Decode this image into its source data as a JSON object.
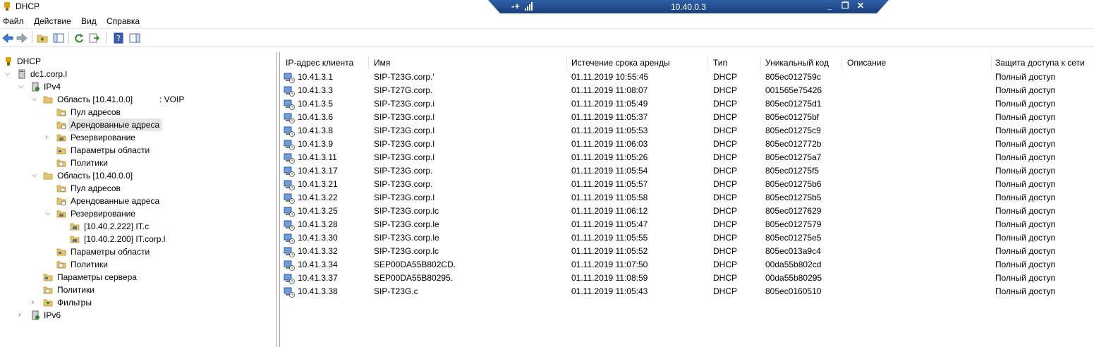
{
  "window": {
    "title": "DHCP"
  },
  "rdp": {
    "ip": "10.40.0.3",
    "pin": "-+",
    "minimize": "_",
    "restore": "❐",
    "close": "✕"
  },
  "menu": {
    "file": "Файл",
    "action": "Действие",
    "view": "Вид",
    "help": "Справка"
  },
  "tree": {
    "root": "DHCP",
    "server": "dc1.corp.l",
    "ipv4": "IPv4",
    "scope1": "Область [10.41.0.0]",
    "scope1_suffix": ": VOIP",
    "pool1": "Пул адресов",
    "leases1": "Арендованные адреса",
    "reservations1": "Резервирование",
    "options1": "Параметры области",
    "policies1": "Политики",
    "scope2": "Область [10.40.0.0]",
    "pool2": "Пул адресов",
    "leases2": "Арендованные адреса",
    "reservations2": "Резервирование",
    "res_a": "[10.40.2.222] IT.c",
    "res_b": "[10.40.2.200] IT.corp.l",
    "options2": "Параметры области",
    "policies2": "Политики",
    "server_options": "Параметры сервера",
    "policies": "Политики",
    "filters": "Фильтры",
    "ipv6": "IPv6"
  },
  "table": {
    "headers": {
      "ip": "IP-адрес клиента",
      "name": "Имя",
      "expiry": "Истечение срока аренды",
      "type": "Тип",
      "uid": "Уникальный код",
      "desc": "Описание",
      "access": "Защита доступа к сети"
    },
    "rows": [
      {
        "ip": "10.41.3.1",
        "name": "SIP-T23G.corp.'",
        "expiry": "01.11.2019 10:55:45",
        "type": "DHCP",
        "uid": "805ec012759c",
        "desc": "",
        "access": "Полный доступ"
      },
      {
        "ip": "10.41.3.3",
        "name": "SIP-T27G.corp.",
        "expiry": "01.11.2019 11:08:07",
        "type": "DHCP",
        "uid": "001565e75426",
        "desc": "",
        "access": "Полный доступ"
      },
      {
        "ip": "10.41.3.5",
        "name": "SIP-T23G.corp.i",
        "expiry": "01.11.2019 11:05:49",
        "type": "DHCP",
        "uid": "805ec01275d1",
        "desc": "",
        "access": "Полный доступ"
      },
      {
        "ip": "10.41.3.6",
        "name": "SIP-T23G.corp.l",
        "expiry": "01.11.2019 11:05:37",
        "type": "DHCP",
        "uid": "805ec01275bf",
        "desc": "",
        "access": "Полный доступ"
      },
      {
        "ip": "10.41.3.8",
        "name": "SIP-T23G.corp.l",
        "expiry": "01.11.2019 11:05:53",
        "type": "DHCP",
        "uid": "805ec01275c9",
        "desc": "",
        "access": "Полный доступ"
      },
      {
        "ip": "10.41.3.9",
        "name": "SIP-T23G.corp.l",
        "expiry": "01.11.2019 11:06:03",
        "type": "DHCP",
        "uid": "805ec012772b",
        "desc": "",
        "access": "Полный доступ"
      },
      {
        "ip": "10.41.3.11",
        "name": "SIP-T23G.corp.l",
        "expiry": "01.11.2019 11:05:26",
        "type": "DHCP",
        "uid": "805ec01275a7",
        "desc": "",
        "access": "Полный доступ"
      },
      {
        "ip": "10.41.3.17",
        "name": "SIP-T23G.corp.",
        "expiry": "01.11.2019 11:05:54",
        "type": "DHCP",
        "uid": "805ec01275f5",
        "desc": "",
        "access": "Полный доступ"
      },
      {
        "ip": "10.41.3.21",
        "name": "SIP-T23G.corp.",
        "expiry": "01.11.2019 11:05:57",
        "type": "DHCP",
        "uid": "805ec01275b6",
        "desc": "",
        "access": "Полный доступ"
      },
      {
        "ip": "10.41.3.22",
        "name": "SIP-T23G.corp.l",
        "expiry": "01.11.2019 11:05:58",
        "type": "DHCP",
        "uid": "805ec01275b5",
        "desc": "",
        "access": "Полный доступ"
      },
      {
        "ip": "10.41.3.25",
        "name": "SIP-T23G.corp.lc",
        "expiry": "01.11.2019 11:06:12",
        "type": "DHCP",
        "uid": "805ec0127629",
        "desc": "",
        "access": "Полный доступ"
      },
      {
        "ip": "10.41.3.28",
        "name": "SIP-T23G.corp.le",
        "expiry": "01.11.2019 11:05:47",
        "type": "DHCP",
        "uid": "805ec0127579",
        "desc": "",
        "access": "Полный доступ"
      },
      {
        "ip": "10.41.3.30",
        "name": "SIP-T23G.corp.le",
        "expiry": "01.11.2019 11:05:55",
        "type": "DHCP",
        "uid": "805ec01275e5",
        "desc": "",
        "access": "Полный доступ"
      },
      {
        "ip": "10.41.3.32",
        "name": "SIP-T23G.corp.lc",
        "expiry": "01.11.2019 11:05:52",
        "type": "DHCP",
        "uid": "805ec013a9c4",
        "desc": "",
        "access": "Полный доступ"
      },
      {
        "ip": "10.41.3.34",
        "name": "SEP00DA55B802CD.",
        "expiry": "01.11.2019 11:07:50",
        "type": "DHCP",
        "uid": "00da55b802cd",
        "desc": "",
        "access": "Полный доступ"
      },
      {
        "ip": "10.41.3.37",
        "name": "SEP00DA55B80295.",
        "expiry": "01.11.2019 11:08:59",
        "type": "DHCP",
        "uid": "00da55b80295",
        "desc": "",
        "access": "Полный доступ"
      },
      {
        "ip": "10.41.3.38",
        "name": "SIP-T23G.c",
        "expiry": "01.11.2019 11:05:43",
        "type": "DHCP",
        "uid": "805ec0160510",
        "desc": "",
        "access": "Полный доступ"
      }
    ]
  },
  "icons": {
    "back": "arrow-left-icon",
    "forward": "arrow-right-icon",
    "up": "folder-up-icon",
    "console_tree": "console-tree-icon",
    "refresh": "refresh-icon",
    "export": "export-list-icon",
    "help": "help-icon",
    "action_pane": "action-pane-icon"
  },
  "colors": {
    "rdp_bar": "#2f5fa5",
    "selection": "#e5e5e5",
    "folder": "#e8c56a"
  }
}
